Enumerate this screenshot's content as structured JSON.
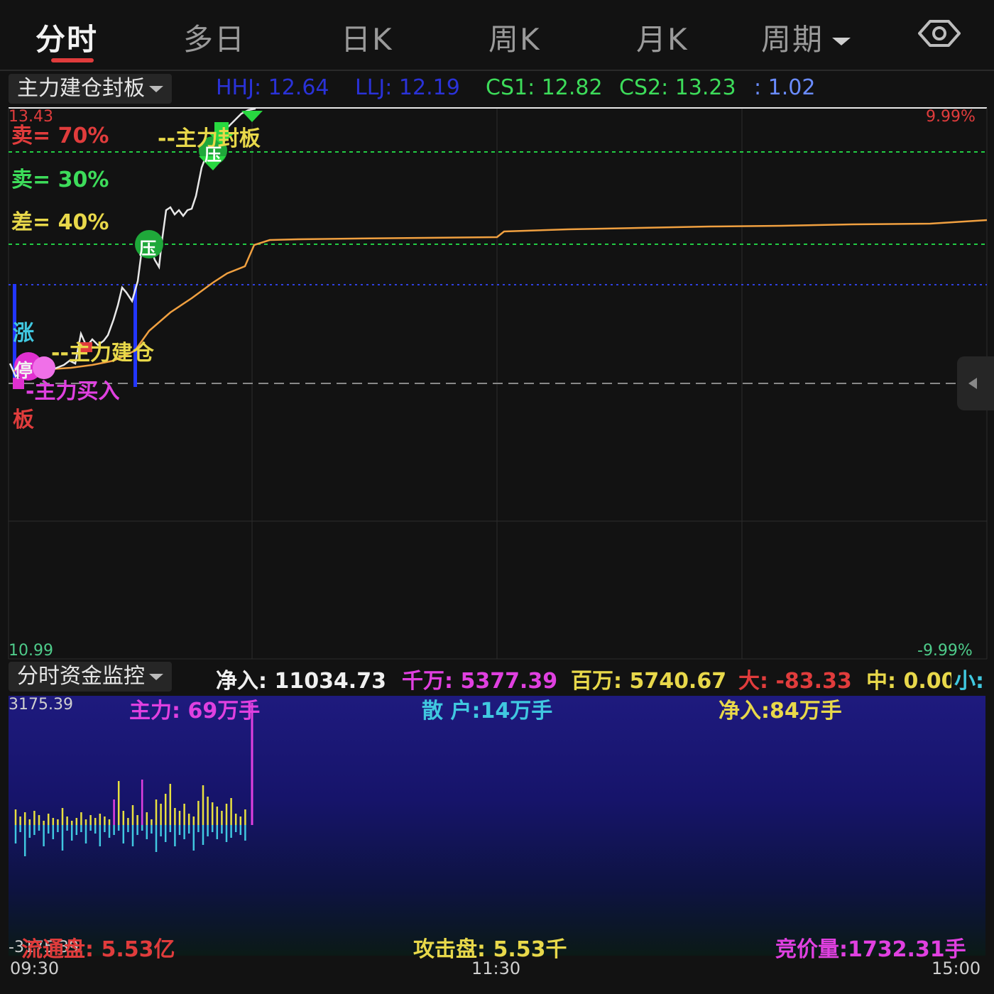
{
  "tabs": [
    {
      "label": "分时",
      "active": true
    },
    {
      "label": "多日"
    },
    {
      "label": "日K"
    },
    {
      "label": "周K"
    },
    {
      "label": "月K"
    },
    {
      "label": "周期",
      "dropdown": true
    }
  ],
  "toolbar": {
    "eye_icon": "eye-icon"
  },
  "indicator": {
    "name": "主力建仓封板",
    "hhj": "HHJ: 12.64",
    "llj": "LLJ: 12.19",
    "cs1": "CS1: 12.82",
    "cs2": "CS2: 13.23",
    "ratio": ": 1.02"
  },
  "price_chart": {
    "top_price": "13.43",
    "bottom_price": "10.99",
    "top_pct": "9.99%",
    "bottom_pct": "-9.99%",
    "sell_70": "卖= 70%",
    "sell_30": "卖= 30%",
    "diff_40": "差= 40%",
    "limit_up_label": "--主力封板",
    "build_label": "--主力建仓",
    "buy_label": "-主力买入",
    "zhang": "涨",
    "ting": "停",
    "ban": "板",
    "press_label": "压"
  },
  "fund_monitor": {
    "name": "分时资金监控",
    "net_in": "净入: 11034.73",
    "qianwan": "千万: 5377.39",
    "baiwan": "百万: 5740.67",
    "da": "大: -83.33",
    "zhong": "中: 0.00",
    "xiao": "小:",
    "scale_top": "3175.39",
    "scale_bottom": "-3175.39",
    "main_force": "主力: 69万手",
    "retail": "散 户:14万手",
    "net_hands": "净入:84万手",
    "float_cap": "流通盘: 5.53亿",
    "attack": "攻击盘: 5.53千",
    "auction": "竞价量:1732.31手"
  },
  "time_axis": [
    "09:30",
    "11:30",
    "15:00"
  ],
  "colors": {
    "up": "#e03c3c",
    "price_line": "#e8e8e8",
    "avg_line": "#f0a040",
    "green": "#22cc44",
    "yellow": "#e8d84a",
    "magenta": "#e040e0",
    "cyan": "#40c8e0"
  }
}
